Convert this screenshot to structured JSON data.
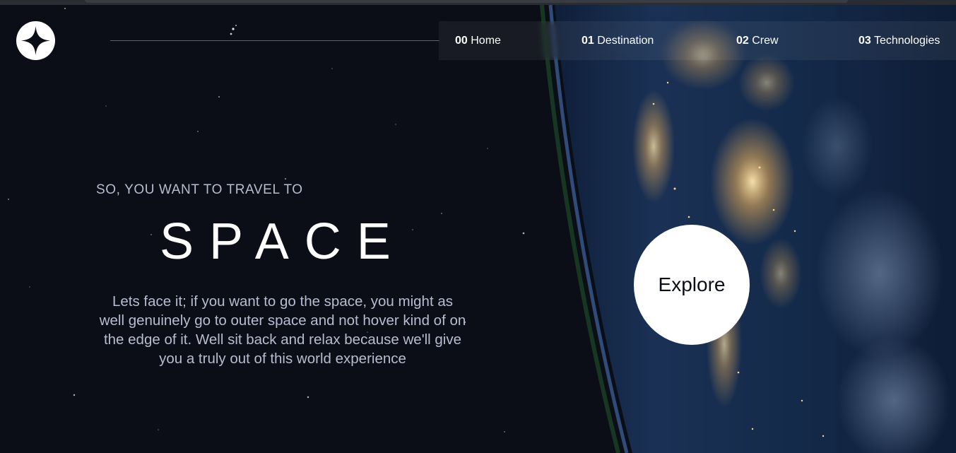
{
  "colors": {
    "background": "#0b0d17",
    "text_muted": "#b8bcd0",
    "text_light": "#ffffff",
    "button_bg": "#ffffff"
  },
  "header": {
    "logo_icon": "four-point-star-icon",
    "nav": [
      {
        "number": "00",
        "label": "Home"
      },
      {
        "number": "01",
        "label": "Destination"
      },
      {
        "number": "02",
        "label": "Crew"
      },
      {
        "number": "03",
        "label": "Technologies"
      }
    ]
  },
  "hero": {
    "eyebrow": "SO, YOU WANT TO TRAVEL TO",
    "title": "SPACE",
    "body": "Lets face it; if you want to go the space, you might as well genuinely go to outer space and not hover kind of on the edge of it. Well sit back and relax because we'll give you a truly out of this world experience",
    "cta_label": "Explore"
  }
}
